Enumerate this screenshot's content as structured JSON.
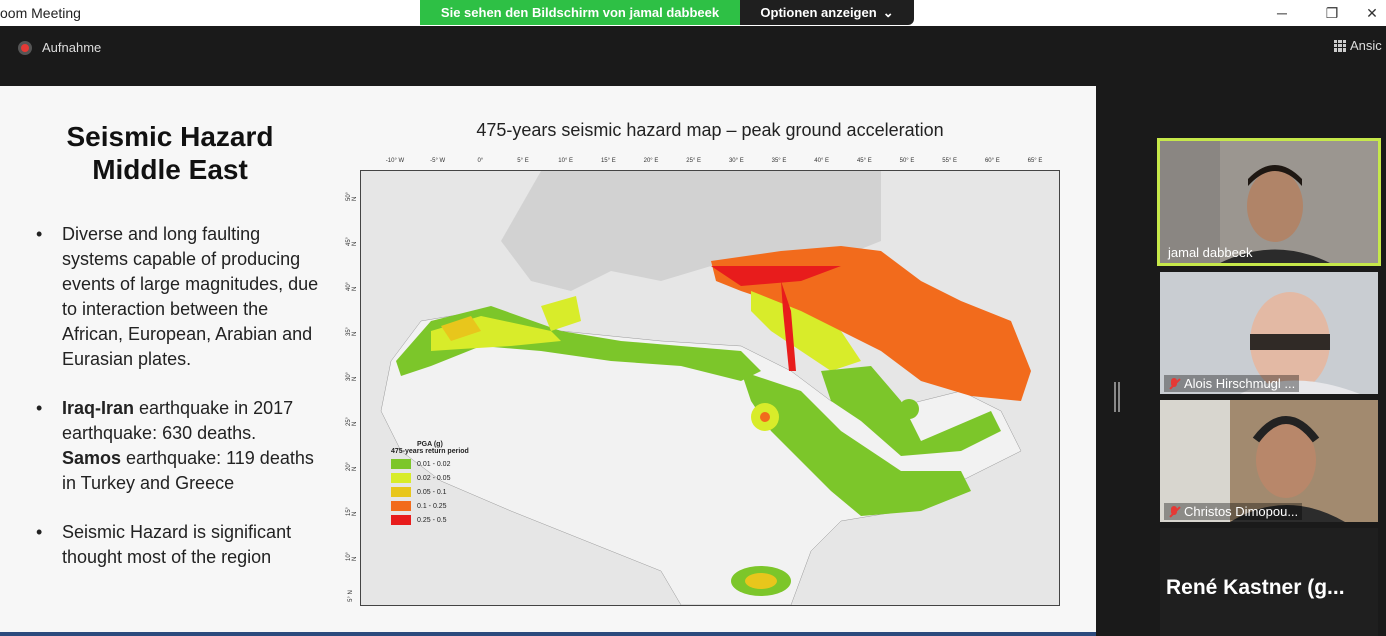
{
  "window": {
    "title": "oom Meeting",
    "share_banner": "Sie sehen den Bildschirm von jamal dabbeek",
    "options_label": "Optionen anzeigen",
    "minimize": "─",
    "restore": "❐",
    "close": "✕"
  },
  "toolbar": {
    "record_label": "Aufnahme",
    "view_label": "Ansic"
  },
  "slide": {
    "title_line1": "Seismic Hazard",
    "title_line2": "Middle East",
    "bullet1": "Diverse and long faulting systems capable of producing events of large magnitudes, due to interaction between the African, European, Arabian and Eurasian plates.",
    "bullet2_bold1": "Iraq-Iran",
    "bullet2_text1": " earthquake in 2017 earthquake: 630 deaths.",
    "bullet2_bold2": "Samos",
    "bullet2_text2": " earthquake: 119 deaths in Turkey and Greece",
    "bullet3": "Seismic Hazard is significant thought most of the region",
    "bullet_char": "•",
    "map_title": "475-years seismic hazard map – peak ground acceleration",
    "lon_labels": [
      "-10° W",
      "-5° W",
      "0°",
      "5° E",
      "10° E",
      "15° E",
      "20° E",
      "25° E",
      "30° E",
      "35° E",
      "40° E",
      "45° E",
      "50° E",
      "55° E",
      "60° E",
      "65° E"
    ],
    "lat_labels": [
      "50° N",
      "45° N",
      "40° N",
      "35° N",
      "30° N",
      "25° N",
      "20° N",
      "15° N",
      "10° N",
      "5° N"
    ],
    "legend_title": "PGA (g)",
    "legend_sub": "475-years return period",
    "legend": [
      {
        "label": "0.01 - 0.02",
        "color": "#7cc62a"
      },
      {
        "label": "0.02 - 0.05",
        "color": "#d8ec2a"
      },
      {
        "label": "0.05 - 0.1",
        "color": "#e8c61c"
      },
      {
        "label": "0.1 - 0.25",
        "color": "#f26b1c"
      },
      {
        "label": "0.25 - 0.5",
        "color": "#e81c1c"
      }
    ]
  },
  "participants": [
    {
      "name": "jamal dabbeek",
      "muted": false,
      "active": true
    },
    {
      "name": "Alois Hirschmugl ...",
      "muted": true,
      "active": false
    },
    {
      "name": "Christos Dimopou...",
      "muted": true,
      "active": false
    },
    {
      "name": "René  Kastner  (g...",
      "muted": true,
      "active": false
    }
  ]
}
